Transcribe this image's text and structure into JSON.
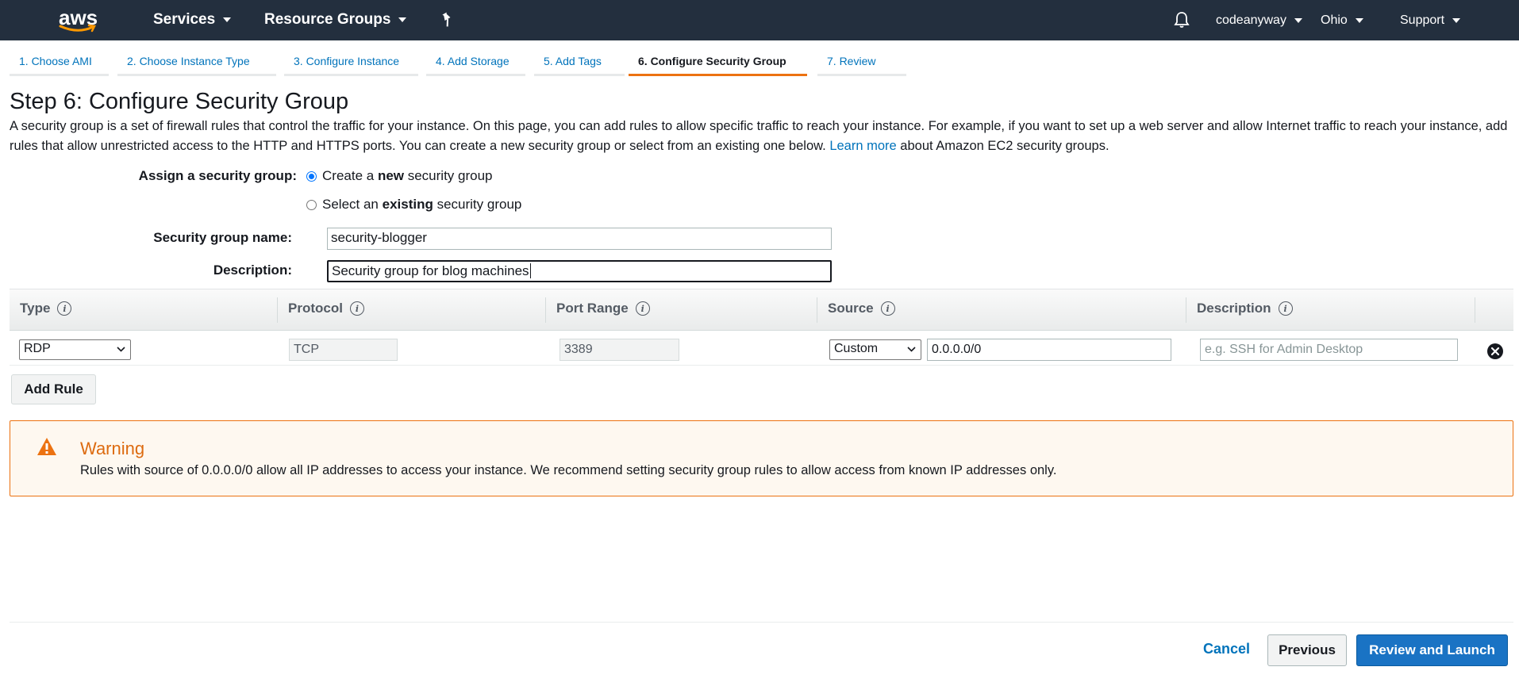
{
  "topnav": {
    "logo_text": "aws",
    "services_label": "Services",
    "resource_groups_label": "Resource Groups",
    "account_label": "codeanyway",
    "region_label": "Ohio",
    "support_label": "Support"
  },
  "tabs": [
    {
      "label": "1. Choose AMI"
    },
    {
      "label": "2. Choose Instance Type"
    },
    {
      "label": "3. Configure Instance"
    },
    {
      "label": "4. Add Storage"
    },
    {
      "label": "5. Add Tags"
    },
    {
      "label": "6. Configure Security Group",
      "active": true
    },
    {
      "label": "7. Review"
    }
  ],
  "page": {
    "title": "Step 6: Configure Security Group",
    "intro_text": "A security group is a set of firewall rules that control the traffic for your instance. On this page, you can add rules to allow specific traffic to reach your instance. For example, if you want to set up a web server and allow Internet traffic to reach your instance, add rules that allow unrestricted access to the HTTP and HTTPS ports. You can create a new security group or select from an existing one below.",
    "learn_more": "Learn more",
    "intro_suffix": "about Amazon EC2 security groups."
  },
  "form": {
    "assign_label": "Assign a security group:",
    "option_new": {
      "prefix": "Create a ",
      "bold": "new",
      "suffix": " security group",
      "selected": true
    },
    "option_existing": {
      "prefix": "Select an ",
      "bold": "existing",
      "suffix": " security group",
      "selected": false
    },
    "name_label": "Security group name:",
    "name_value": "security-blogger",
    "description_label": "Description:",
    "description_value": "Security group for blog machines"
  },
  "rules": {
    "columns": [
      "Type",
      "Protocol",
      "Port Range",
      "Source",
      "Description"
    ],
    "rows": [
      {
        "type": "RDP",
        "protocol": "TCP",
        "port_range": "3389",
        "source_mode": "Custom",
        "source_value": "0.0.0.0/0",
        "description_placeholder": "e.g. SSH for Admin Desktop"
      }
    ],
    "add_rule_label": "Add Rule"
  },
  "warning": {
    "title": "Warning",
    "text": "Rules with source of 0.0.0.0/0 allow all IP addresses to access your instance. We recommend setting security group rules to allow access from known IP addresses only."
  },
  "footer": {
    "cancel_label": "Cancel",
    "previous_label": "Previous",
    "review_launch_label": "Review and Launch"
  },
  "colors": {
    "nav_bg": "#232f3e",
    "accent_orange": "#ec7211",
    "link_blue": "#0073bb",
    "primary_button": "#1a73c4",
    "warning_bg": "#fef8f0"
  }
}
